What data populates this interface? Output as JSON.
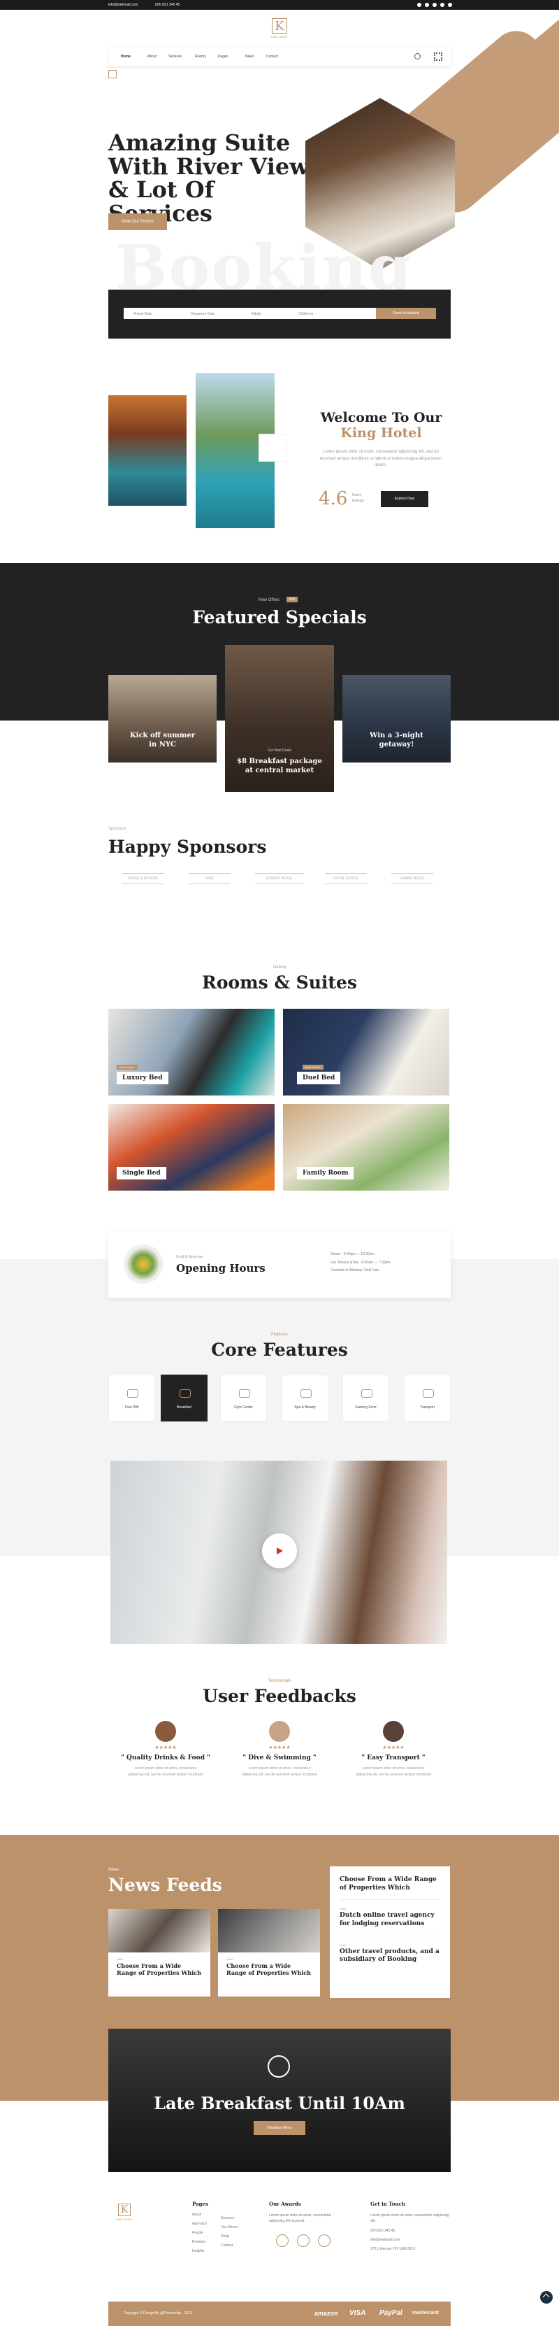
{
  "topbar": {
    "email": "info@webmail.com",
    "phone": "(00) 821 345 45"
  },
  "logo": {
    "letter": "K",
    "name": "KING HOTEL"
  },
  "nav": {
    "items": [
      "Home",
      "About",
      "Services",
      "Rooms",
      "Pages",
      "News",
      "Contact"
    ]
  },
  "hero": {
    "line1": "Amazing Suite",
    "line2": "With River View",
    "line3": "& Lot Of Services",
    "cta": "View Our Rooms",
    "watermark": "Booking"
  },
  "booking": {
    "fields": [
      "Arrival Date",
      "Departure Date",
      "Adults",
      "Childrens"
    ],
    "submit": "Check Availability"
  },
  "welcome": {
    "title1": "Welcome To Our",
    "title2": "King Hotel",
    "text": "Lorem ipsum dolor sit amet, consectetur adipiscing elit, sed do eiusmod tempor incididunt ut labore et dolore magna aliqua lorem ipsum.",
    "rating": "4.6",
    "rating_label1": "Users",
    "rating_label2": "Ratings",
    "cta": "Explore Now"
  },
  "specials": {
    "kicker": "New Offers",
    "badge": "Hot",
    "title": "Featured Specials",
    "cards": [
      {
        "title1": "Kick off summer",
        "title2": "in NYC"
      },
      {
        "tag": "Our Best Deals",
        "title1": "$8 Breakfast package",
        "title2": "at central market"
      },
      {
        "title1": "Win a 3-night",
        "title2": "getaway!"
      }
    ]
  },
  "sponsors": {
    "kicker": "Sponsors",
    "title": "Happy Sponsors",
    "logos": [
      "HOTEL & RESORT",
      "KING",
      "LUXURY HOTEL",
      "ROYAL SUITES",
      "GRAND HOTEL"
    ]
  },
  "rooms": {
    "kicker": "Gallery",
    "title": "Rooms & Suites",
    "items": [
      {
        "tag": "Best Choice",
        "name": "Luxury Bed"
      },
      {
        "tag": "Best Choice",
        "name": "Duel Bed"
      },
      {
        "name": "Single Bed"
      },
      {
        "name": "Family Room"
      }
    ]
  },
  "hours": {
    "kicker": "Food & Beverage",
    "title": "Opening Hours",
    "lines": [
      "Dinner : 6:00pm — 10:30pm",
      "Our Terrace & Bar : 6:00am — 7:00pm",
      "Cocktails & Whiskey: Until 1am"
    ]
  },
  "features": {
    "kicker": "Features",
    "title": "Core Features",
    "items": [
      "Free Wifi",
      "Breakfast",
      "Gym Center",
      "Spa & Beauty",
      "Gaming Zone",
      "Transport"
    ]
  },
  "feedback": {
    "kicker": "Testimonials",
    "title": "User Feedbacks",
    "stars": "★★★★★",
    "items": [
      {
        "quote": "\" Quality Drinks & Food \"",
        "text": "Lorem ipsum dolor sit amet, consectetur adipiscing elit, sed do eiusmod tempor incididunt"
      },
      {
        "quote": "\" Dive & Swimming \"",
        "text": "Lorem ipsum dolor sit amet, consectetur adipiscing elit, sed do eiusmod tempor incididunt"
      },
      {
        "quote": "\" Easy Transport \"",
        "text": "Lorem ipsum dolor sit amet, consectetur adipiscing elit, sed do eiusmod tempor incididunt"
      }
    ]
  },
  "news": {
    "kicker": "News",
    "title": "News Feeds",
    "cards": [
      {
        "tag": "Hotel",
        "title": "Choose From a Wide Range of Properties Which"
      },
      {
        "tag": "Hotel",
        "title": "Choose From a Wide Range of Properties Which"
      }
    ],
    "list": [
      {
        "title": "Choose From a Wide Range of Properties Which"
      },
      {
        "tag": "Hotel",
        "title": "Dutch online travel agency for lodging reservations"
      },
      {
        "tag": "Hotel",
        "title": "Other travel products, and a subsidiary of Booking"
      }
    ]
  },
  "banner": {
    "title": "Late Breakfast Until 10Am",
    "cta": "Breakfast Menu"
  },
  "footer": {
    "pages_title": "Pages",
    "pages_a": [
      "About",
      "Approach",
      "People",
      "Reviews",
      "Insights"
    ],
    "pages_b": [
      "Services",
      "Our Menus",
      "Shop",
      "Contact"
    ],
    "awards_title": "Our Awards",
    "awards_text": "Lorem ipsum dolor sit amet, consectetur adipiscing elit eiusmod.",
    "touch_title": "Get in Touch",
    "touch_text": "Lorem ipsum dolor sit amet, consectetur adipiscing elit.",
    "phone": "(00) 821 345 45",
    "email": "info@webmail.com",
    "address": "172 L Avenue, NY USA 2019",
    "copyright": "Copyright © Design By @Themeollar - 2023",
    "payments": [
      "amazon",
      "VISA",
      "PayPal",
      "mastercard"
    ]
  }
}
